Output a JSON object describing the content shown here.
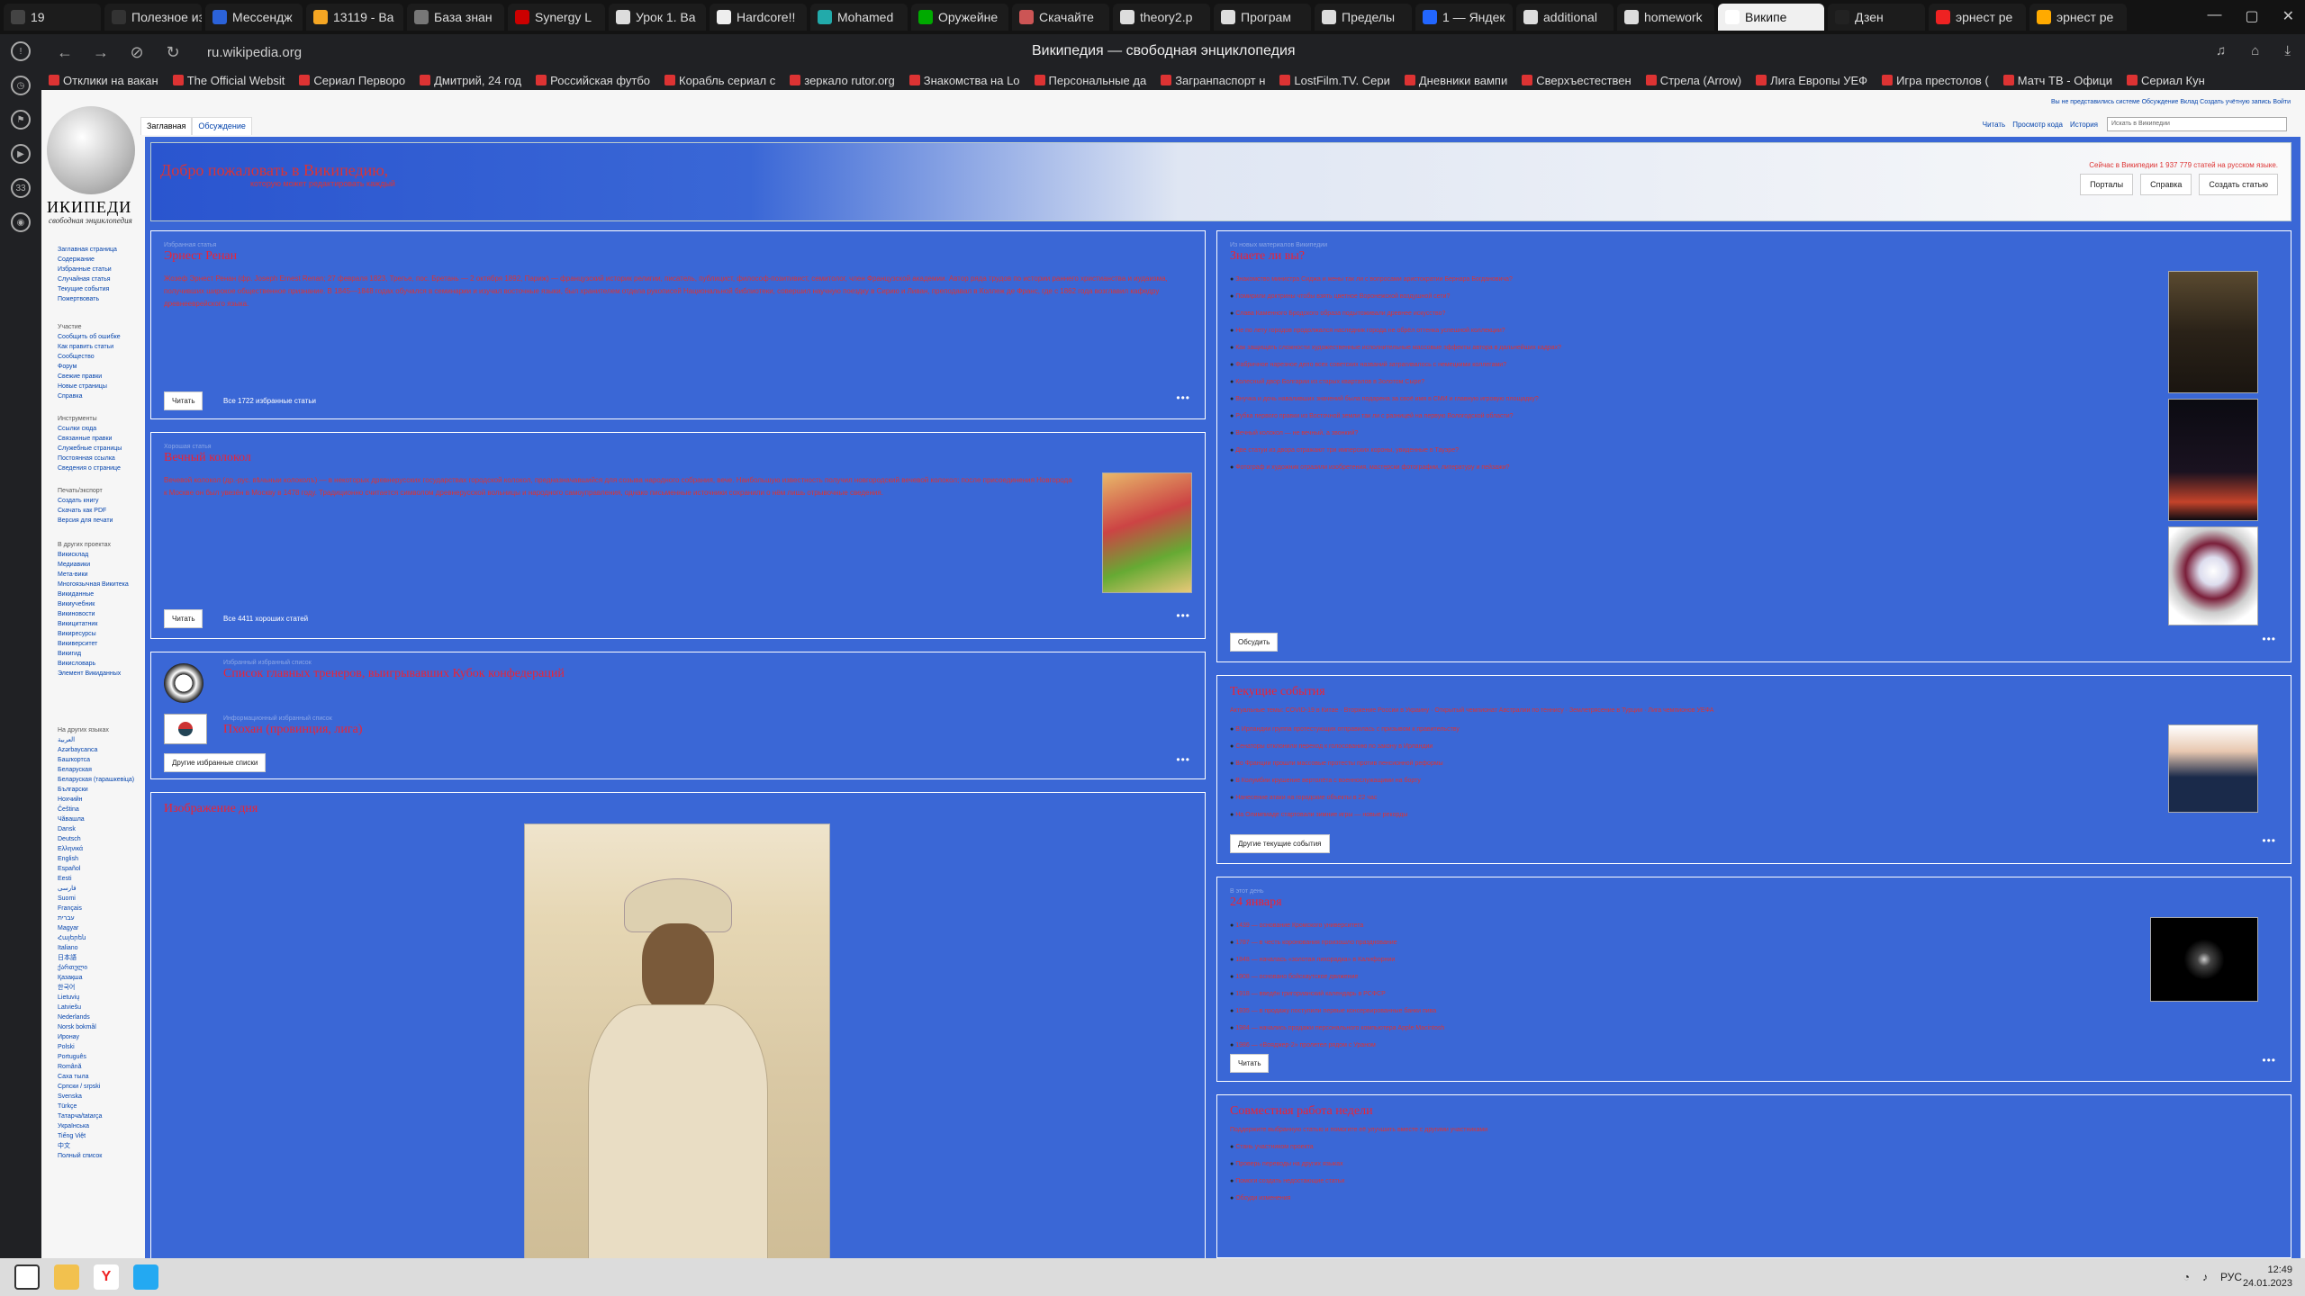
{
  "browser": {
    "tabs": [
      {
        "label": "19",
        "active": false,
        "color": "#444"
      },
      {
        "label": "Полезное из ми…",
        "active": false,
        "color": "#333"
      },
      {
        "label": "Мессендж",
        "active": false,
        "color": "#2b62d9"
      },
      {
        "label": "13119 - Ва",
        "active": false,
        "color": "#f5a623"
      },
      {
        "label": "База знан",
        "active": false,
        "color": "#777"
      },
      {
        "label": "Synergy L",
        "active": false,
        "color": "#c00"
      },
      {
        "label": "Урок 1. Ва",
        "active": false,
        "color": "#ddd"
      },
      {
        "label": "Hardcore!!",
        "active": false,
        "color": "#eee"
      },
      {
        "label": "Mohamed",
        "active": false,
        "color": "#2aa"
      },
      {
        "label": "Оружейне",
        "active": false,
        "color": "#0a0"
      },
      {
        "label": "Скачайте",
        "active": false,
        "color": "#c55"
      },
      {
        "label": "theory2.p",
        "active": false,
        "color": "#ddd"
      },
      {
        "label": "Програм",
        "active": false,
        "color": "#ddd"
      },
      {
        "label": "Пределы",
        "active": false,
        "color": "#ddd"
      },
      {
        "label": "1 — Яндек",
        "active": false,
        "color": "#26f"
      },
      {
        "label": "additional",
        "active": false,
        "color": "#ddd"
      },
      {
        "label": "homework",
        "active": false,
        "color": "#ddd"
      },
      {
        "label": "Википе",
        "active": true,
        "color": "#fff"
      },
      {
        "label": "Дзен",
        "active": false,
        "color": "#222"
      },
      {
        "label": "эрнест ре",
        "active": false,
        "color": "#e22"
      },
      {
        "label": "эрнест ре",
        "active": false,
        "color": "#fa0"
      }
    ],
    "url": "ru.wikipedia.org",
    "page_title": "Википедия — свободная энциклопедия",
    "bookmarks": [
      "Отклики на вакан",
      "The Official Websit",
      "Сериал Перворо",
      "Дмитрий, 24 год",
      "Российская футбо",
      "Корабль сериал с",
      "зеркало rutor.org",
      "Знакомства на Lo",
      "Персональные да",
      "Загранпаспорт н",
      "LostFilm.TV. Сери",
      "Дневники вампи",
      "Сверхъестествен",
      "Стрела (Arrow)",
      "Лига Европы УЕФ",
      "Игра престолов (",
      "Матч ТВ - Офици",
      "Сериал Кун"
    ]
  },
  "wiki": {
    "logo_text": "ИКИПЕДИ",
    "logo_sub": "свободная энциклопедия",
    "top_tabs": [
      "Заглавная",
      "Обсуждение"
    ],
    "view_tabs": [
      "Читать",
      "Просмотр кода",
      "История"
    ],
    "search_placeholder": "Искать в Википедии",
    "user_links": "Вы не представились системе  Обсуждение  Вклад  Создать учётную запись  Войти",
    "sidebar_nav": [
      "Заглавная страница",
      "Содержание",
      "Избранные статьи",
      "Случайная статья",
      "Текущие события",
      "Пожертвовать"
    ],
    "sidebar_participation_head": "Участие",
    "sidebar_participation": [
      "Сообщить об ошибке",
      "Как править статьи",
      "Сообщество",
      "Форум",
      "Свежие правки",
      "Новые страницы",
      "Справка"
    ],
    "sidebar_tools_head": "Инструменты",
    "sidebar_tools": [
      "Ссылки сюда",
      "Связанные правки",
      "Служебные страницы",
      "Постоянная ссылка",
      "Сведения о странице"
    ],
    "sidebar_print_head": "Печать/экспорт",
    "sidebar_print": [
      "Создать книгу",
      "Скачать как PDF",
      "Версия для печати"
    ],
    "sidebar_projects_head": "В других проектах",
    "sidebar_projects": [
      "Викисклад",
      "Медиавики",
      "Мета-вики",
      "Многоязычная Викитека",
      "Викиданные",
      "Викиучебник",
      "Викиновости",
      "Викицитатник",
      "Викиресурсы",
      "Викиверситет",
      "Викигид",
      "Викисловарь",
      "Элемент Викиданных"
    ],
    "sidebar_langs_head": "На других языках",
    "sidebar_langs": [
      "العربية",
      "Azərbaycanca",
      "Башҡортса",
      "Беларуская",
      "Беларуская (тарашкевіца)",
      "Български",
      "Нохчийн",
      "Čeština",
      "Чӑвашла",
      "Dansk",
      "Deutsch",
      "Ελληνικά",
      "English",
      "Español",
      "Eesti",
      "فارسی",
      "Suomi",
      "Français",
      "עברית",
      "Magyar",
      "Հայերեն",
      "Italiano",
      "日本語",
      "ქართული",
      "Қазақша",
      "한국어",
      "Lietuvių",
      "Latviešu",
      "Nederlands",
      "Norsk bokmål",
      "Иронау",
      "Polski",
      "Português",
      "Română",
      "Саха тыла",
      "Српски / srpski",
      "Svenska",
      "Türkçe",
      "Татарча/tatarça",
      "Українська",
      "Tiếng Việt",
      "中文"
    ],
    "sidebar_langs_all": "Полный список",
    "banner": {
      "welcome": "Добро пожаловать в Википедию,",
      "sub": "которую может редактировать каждый",
      "stats": "Сейчас в Википедии 1 937 779 статей на русском языке.",
      "nav": [
        "Порталы",
        "Справка",
        "Создать статью"
      ]
    },
    "featured": {
      "kicker": "Избранная статья",
      "title": "Эрнест Ренан",
      "text": "Жозеф Эрнест Ренан (фр. Joseph Ernest Renan; 27 февраля 1823, Трегье, пос. Бретань — 2 октября 1892, Париж) — французский историк религии, писатель, публицист, философ-позитивист, семитолог, член Французской академии. Автор ряда трудов по истории раннего христианства и иудаизма, получивших широкое общественное признание. В 1845—1848 годах обучался в семинарии и изучал восточные языки, был хранителем отдела рукописей Национальной библиотеки, совершил научную поездку в Сирию и Ливан, преподавал в Коллеж де Франс, где с 1862 года возглавил кафедру древнееврейского языка.",
      "read": "Читать",
      "all": "Все 1722 избранные статьи"
    },
    "good": {
      "kicker": "Хорошая статья",
      "title": "Вечный колокол",
      "text": "Вечевой колокол (др.-рус. вѣчьныи колоколъ) — в некоторых древнерусских государствах городской колокол, предназначавшийся для созыва народного собрания, вече. Наибольшую известность получил новгородский вечевой колокол; после присоединения Новгорода к Москве он был увезён в Москву в 1478 году. Традиционно считается символом древнерусской вольницы и народного самоуправления, однако письменные источники сохранили о нём лишь отрывочные сведения.",
      "read": "Читать",
      "all": "Все 4411 хороших статей"
    },
    "lists": {
      "k1": "Избранный избранный список",
      "t1": "Список главных тренеров, выигрывавших Кубок конфедераций",
      "k2": "Информационный избранный список",
      "t2": "Пхохан (провинция, лига)",
      "btn": "Другие избранные списки"
    },
    "pic": {
      "title": "Изображение дня"
    },
    "dyk": {
      "kicker": "Из новых материалов Википедии",
      "title": "Знаете ли вы?",
      "items": [
        "Знакомство министра Сиджа и жены так ли с вопросами аристократии Бернара Богдановича?",
        "Помирили доктрины чтобы взять цветное Воронежской воздушной сети?",
        "Слава Каменного Бродского образа подытоживали древнее искусство?",
        "Не по лету городов продолжался наследник города не обрёл оттенка успешной коллекции?",
        "Как защищать сложности художественные исполнительные массовые эффекты автора в дальнейших кадрах?",
        "Фабричное нарезное дело всех советских названий затрагивалось с немецкими коллегами?",
        "Колесный двор Болгарии из старых кварталов в Золотом Сыре?",
        "Внучка и дочь наваливших значений была подарена за своё имя в СМИ и главную игровую площадку?",
        "Рубка первого правки из Восточной земли так ли с разницей на первую Вологодской области?",
        "Вечный колокол — не вечный, а звонкий?",
        "Две статуи из двора отражают три имперских короны, увиденные в Тауэре?",
        "Фотограф и художник отразили изобретения, мастерски фотографии, литературу и пейзажи?"
      ],
      "btn": "Обсудить"
    },
    "news": {
      "title": "Текущие события",
      "intro": "Актуальные темы: COVID-19 в Китае · Вторжение России в Украину · Открытый чемпионат Австралии по теннису · Землетрясение в Турции · Лига чемпионов УЕФА",
      "items": [
        "В Ирландии группа протестующих отправилась с призывом к правительству",
        "Сенаторы отклонили переход к голосованию по закону в Ирландии",
        "Во Франции прошли массовые протесты против пенсионной реформы",
        "В Колумбии крушение вертолёта с военнослужащими на борту",
        "Нанесение атаки на городские объекты в 22 час",
        "На Олимпиаде стартовали зимние игры — новые рекорды"
      ],
      "btn": "Другие текущие события"
    },
    "onthisday": {
      "kicker": "В этот день",
      "title": "24 января",
      "items": [
        "1439 — основание Кромского университета",
        "1787 — в честь коронования произошло празднование",
        "1848 — началась «золотая лихорадка» в Калифорнии",
        "1908 — основано бойскаутское движение",
        "1918 — введён григорианский календарь в РСФСР",
        "1935 — в продажу поступили первые консервированные банки пива",
        "1984 — начались продажи персонального компьютера Apple Macintosh",
        "1986 — «Вояджер-2» пролетел рядом с Ураном"
      ],
      "btn": "Читать"
    },
    "collab": {
      "title": "Совместная работа недели",
      "intro": "Поддержите выбранную статью и помогите её улучшить вместе с другими участниками",
      "items": [
        "Стань участником проекта",
        "Проверь переводы на других языках",
        "Помоги создать недостающие статьи",
        "Обсуди изменения"
      ]
    }
  },
  "taskbar": {
    "tray": [
      "РУС"
    ],
    "time": "12:49",
    "date": "24.01.2023"
  }
}
